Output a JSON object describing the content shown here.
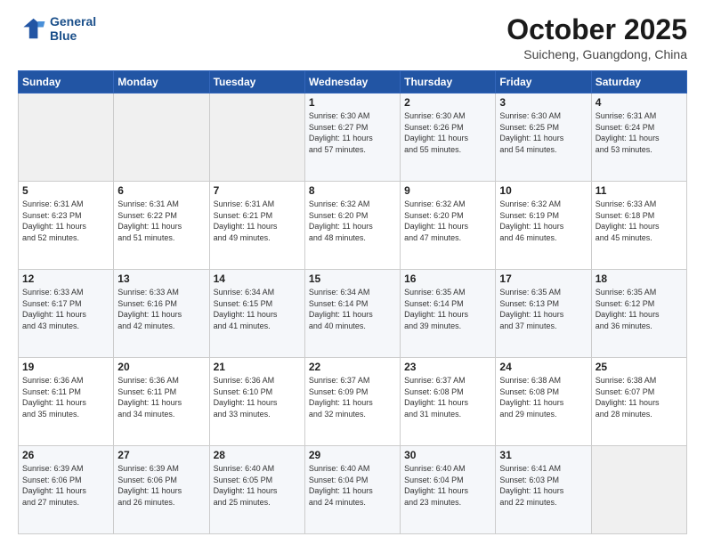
{
  "header": {
    "logo_line1": "General",
    "logo_line2": "Blue",
    "month": "October 2025",
    "location": "Suicheng, Guangdong, China"
  },
  "weekdays": [
    "Sunday",
    "Monday",
    "Tuesday",
    "Wednesday",
    "Thursday",
    "Friday",
    "Saturday"
  ],
  "weeks": [
    [
      {
        "day": "",
        "info": ""
      },
      {
        "day": "",
        "info": ""
      },
      {
        "day": "",
        "info": ""
      },
      {
        "day": "1",
        "info": "Sunrise: 6:30 AM\nSunset: 6:27 PM\nDaylight: 11 hours\nand 57 minutes."
      },
      {
        "day": "2",
        "info": "Sunrise: 6:30 AM\nSunset: 6:26 PM\nDaylight: 11 hours\nand 55 minutes."
      },
      {
        "day": "3",
        "info": "Sunrise: 6:30 AM\nSunset: 6:25 PM\nDaylight: 11 hours\nand 54 minutes."
      },
      {
        "day": "4",
        "info": "Sunrise: 6:31 AM\nSunset: 6:24 PM\nDaylight: 11 hours\nand 53 minutes."
      }
    ],
    [
      {
        "day": "5",
        "info": "Sunrise: 6:31 AM\nSunset: 6:23 PM\nDaylight: 11 hours\nand 52 minutes."
      },
      {
        "day": "6",
        "info": "Sunrise: 6:31 AM\nSunset: 6:22 PM\nDaylight: 11 hours\nand 51 minutes."
      },
      {
        "day": "7",
        "info": "Sunrise: 6:31 AM\nSunset: 6:21 PM\nDaylight: 11 hours\nand 49 minutes."
      },
      {
        "day": "8",
        "info": "Sunrise: 6:32 AM\nSunset: 6:20 PM\nDaylight: 11 hours\nand 48 minutes."
      },
      {
        "day": "9",
        "info": "Sunrise: 6:32 AM\nSunset: 6:20 PM\nDaylight: 11 hours\nand 47 minutes."
      },
      {
        "day": "10",
        "info": "Sunrise: 6:32 AM\nSunset: 6:19 PM\nDaylight: 11 hours\nand 46 minutes."
      },
      {
        "day": "11",
        "info": "Sunrise: 6:33 AM\nSunset: 6:18 PM\nDaylight: 11 hours\nand 45 minutes."
      }
    ],
    [
      {
        "day": "12",
        "info": "Sunrise: 6:33 AM\nSunset: 6:17 PM\nDaylight: 11 hours\nand 43 minutes."
      },
      {
        "day": "13",
        "info": "Sunrise: 6:33 AM\nSunset: 6:16 PM\nDaylight: 11 hours\nand 42 minutes."
      },
      {
        "day": "14",
        "info": "Sunrise: 6:34 AM\nSunset: 6:15 PM\nDaylight: 11 hours\nand 41 minutes."
      },
      {
        "day": "15",
        "info": "Sunrise: 6:34 AM\nSunset: 6:14 PM\nDaylight: 11 hours\nand 40 minutes."
      },
      {
        "day": "16",
        "info": "Sunrise: 6:35 AM\nSunset: 6:14 PM\nDaylight: 11 hours\nand 39 minutes."
      },
      {
        "day": "17",
        "info": "Sunrise: 6:35 AM\nSunset: 6:13 PM\nDaylight: 11 hours\nand 37 minutes."
      },
      {
        "day": "18",
        "info": "Sunrise: 6:35 AM\nSunset: 6:12 PM\nDaylight: 11 hours\nand 36 minutes."
      }
    ],
    [
      {
        "day": "19",
        "info": "Sunrise: 6:36 AM\nSunset: 6:11 PM\nDaylight: 11 hours\nand 35 minutes."
      },
      {
        "day": "20",
        "info": "Sunrise: 6:36 AM\nSunset: 6:11 PM\nDaylight: 11 hours\nand 34 minutes."
      },
      {
        "day": "21",
        "info": "Sunrise: 6:36 AM\nSunset: 6:10 PM\nDaylight: 11 hours\nand 33 minutes."
      },
      {
        "day": "22",
        "info": "Sunrise: 6:37 AM\nSunset: 6:09 PM\nDaylight: 11 hours\nand 32 minutes."
      },
      {
        "day": "23",
        "info": "Sunrise: 6:37 AM\nSunset: 6:08 PM\nDaylight: 11 hours\nand 31 minutes."
      },
      {
        "day": "24",
        "info": "Sunrise: 6:38 AM\nSunset: 6:08 PM\nDaylight: 11 hours\nand 29 minutes."
      },
      {
        "day": "25",
        "info": "Sunrise: 6:38 AM\nSunset: 6:07 PM\nDaylight: 11 hours\nand 28 minutes."
      }
    ],
    [
      {
        "day": "26",
        "info": "Sunrise: 6:39 AM\nSunset: 6:06 PM\nDaylight: 11 hours\nand 27 minutes."
      },
      {
        "day": "27",
        "info": "Sunrise: 6:39 AM\nSunset: 6:06 PM\nDaylight: 11 hours\nand 26 minutes."
      },
      {
        "day": "28",
        "info": "Sunrise: 6:40 AM\nSunset: 6:05 PM\nDaylight: 11 hours\nand 25 minutes."
      },
      {
        "day": "29",
        "info": "Sunrise: 6:40 AM\nSunset: 6:04 PM\nDaylight: 11 hours\nand 24 minutes."
      },
      {
        "day": "30",
        "info": "Sunrise: 6:40 AM\nSunset: 6:04 PM\nDaylight: 11 hours\nand 23 minutes."
      },
      {
        "day": "31",
        "info": "Sunrise: 6:41 AM\nSunset: 6:03 PM\nDaylight: 11 hours\nand 22 minutes."
      },
      {
        "day": "",
        "info": ""
      }
    ]
  ]
}
